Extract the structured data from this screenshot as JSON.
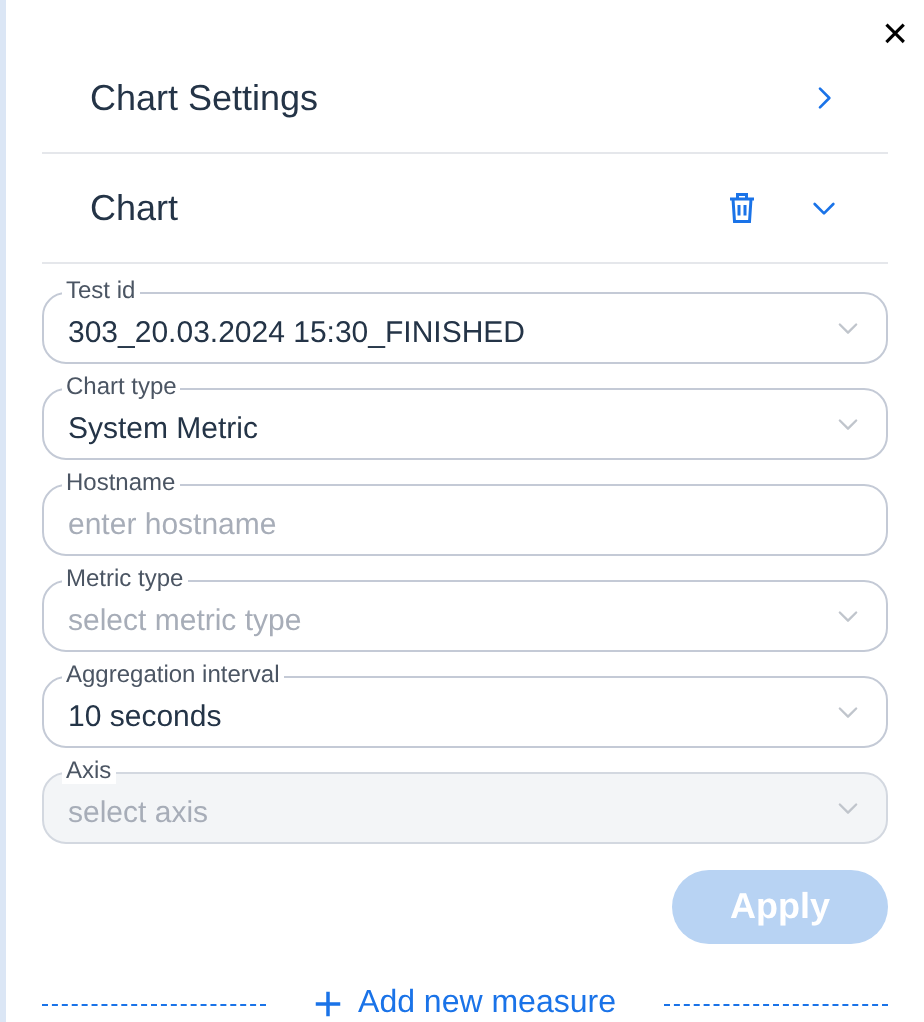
{
  "close_label": "×",
  "sections": [
    {
      "title": "Chart Settings",
      "kind": "link"
    },
    {
      "title": "Chart",
      "kind": "expanded"
    }
  ],
  "fields": [
    {
      "label": "Test id",
      "kind": "select",
      "value": "303_20.03.2024 15:30_FINISHED",
      "disabled": false
    },
    {
      "label": "Chart type",
      "kind": "select",
      "value": "System Metric",
      "disabled": false
    },
    {
      "label": "Hostname",
      "kind": "text",
      "placeholder": "enter hostname",
      "disabled": false
    },
    {
      "label": "Metric type",
      "kind": "select",
      "placeholder": "select metric type",
      "disabled": false
    },
    {
      "label": "Aggregation interval",
      "kind": "select",
      "value": "10 seconds",
      "disabled": false
    },
    {
      "label": "Axis",
      "kind": "select",
      "placeholder": "select axis",
      "disabled": true
    }
  ],
  "apply": {
    "label": "Apply",
    "disabled": true
  },
  "add_measure": {
    "label": "Add new measure"
  }
}
